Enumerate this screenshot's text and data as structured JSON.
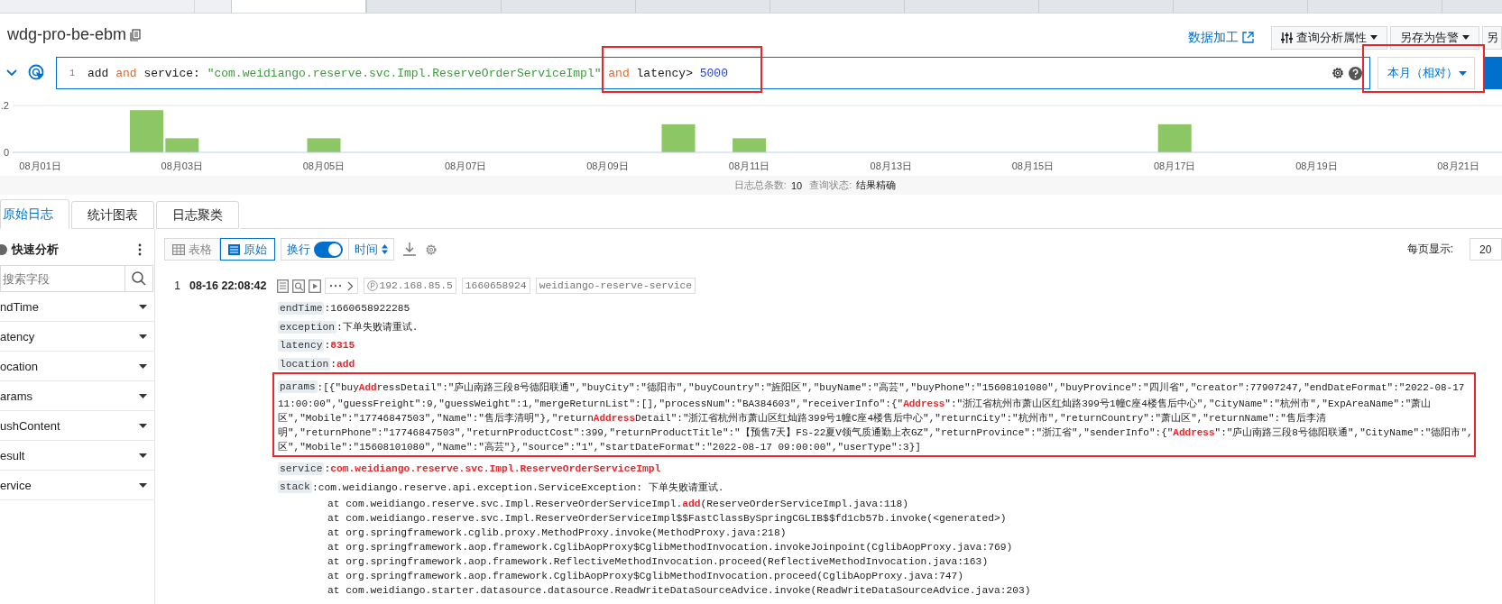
{
  "top_tabs": [
    {
      "selected": true
    },
    {
      "selected": false
    },
    {
      "selected": false
    },
    {
      "selected": false
    },
    {
      "selected": false
    },
    {
      "selected": false
    },
    {
      "selected": false
    },
    {
      "selected": false
    },
    {
      "selected": false
    },
    {
      "selected": false
    }
  ],
  "title": "wdg-pro-be-ebm",
  "header_actions": {
    "link": "数据加工",
    "buttons": [
      {
        "label": "查询分析属性",
        "kind": "attributes"
      },
      {
        "label": "另存为告警",
        "kind": "menu"
      },
      {
        "label": "另",
        "kind": "plain"
      }
    ]
  },
  "query": {
    "line_number": "1",
    "tokens": [
      {
        "text": "add",
        "kind": "plain"
      },
      {
        "text": "and",
        "kind": "keyword"
      },
      {
        "text": "service:",
        "kind": "plain"
      },
      {
        "text": "\"com.weidiango.reserve.svc.Impl.ReserveOrderServiceImpl\"",
        "kind": "string"
      },
      {
        "text": "and",
        "kind": "keyword"
      },
      {
        "text": "latency>",
        "kind": "plain"
      },
      {
        "text": "5000",
        "kind": "number"
      }
    ],
    "time_range": "本月（相对）"
  },
  "histogram": {
    "chart_data": {
      "type": "bar",
      "ylim": [
        0,
        0.2
      ],
      "yticks": [
        0,
        {
          "value": 0.2,
          "label": ".2"
        }
      ],
      "categories": [
        "08月01日",
        null,
        null,
        null,
        "08月03日",
        null,
        null,
        null,
        "08月05日",
        null,
        null,
        null,
        "08月07日",
        null,
        null,
        null,
        "08月09日",
        null,
        null,
        null,
        "08月11日",
        null,
        null,
        null,
        "08月13日",
        null,
        null,
        null,
        "08月15日",
        null,
        null,
        null,
        "08月17日",
        null,
        null,
        null,
        "08月19日",
        null,
        null,
        null,
        "08月21日",
        null
      ],
      "values": [
        0,
        0,
        0,
        0.18,
        0.06,
        0,
        0,
        0,
        0.06,
        0,
        0,
        0,
        0,
        0,
        0,
        0,
        0,
        0,
        0.12,
        0,
        0.06,
        0,
        0,
        0,
        0,
        0,
        0,
        0,
        0,
        0,
        0,
        0,
        0.12,
        0,
        0,
        0,
        0,
        0,
        0,
        0,
        0,
        0
      ]
    }
  },
  "summary": [
    {
      "label": "日志总条数:",
      "value": "10"
    },
    {
      "label": "查询状态:",
      "value": "结果精确"
    }
  ],
  "result_tabs": [
    {
      "label": "原始日志",
      "selected": true
    },
    {
      "label": "统计图表",
      "selected": false
    },
    {
      "label": "日志聚类",
      "selected": false
    }
  ],
  "sidebar": {
    "title": "快速分析",
    "search_placeholder": "搜索字段",
    "fields": [
      "ndTime",
      "atency",
      "ocation",
      "arams",
      "ushContent",
      "esult",
      "ervice"
    ]
  },
  "toolbar": {
    "views": [
      {
        "label": "表格",
        "kind": "table",
        "selected": false
      },
      {
        "label": "原始",
        "kind": "raw",
        "selected": true
      }
    ],
    "wrap": {
      "label": "换行",
      "on": true
    },
    "sort": {
      "label": "时间"
    },
    "page_size": {
      "label": "每页显示:",
      "value": "20"
    }
  },
  "log": {
    "index": "1",
    "time": "08-16 22:08:42",
    "tags": [
      {
        "text": "192.168.85.5",
        "kind": "ip"
      },
      {
        "text": "1660658924",
        "kind": "plain"
      },
      {
        "text": "weidiango-reserve-service",
        "kind": "plain"
      }
    ],
    "fields": [
      {
        "key": "endTime",
        "lines": [
          ":1660658922285"
        ]
      },
      {
        "key": "exception",
        "lines": [
          ":下单失败请重试."
        ]
      },
      {
        "key": "latency",
        "lines": [
          ":**8315**"
        ]
      },
      {
        "key": "location",
        "lines": [
          ":**add**"
        ]
      },
      {
        "key": "params",
        "lines": [
          ":[{\"buy**Add**ressDetail\":\"庐山南路三段8号德阳联通\",\"buyCity\":\"德阳市\",\"buyCountry\":\"旌阳区\",\"buyName\":\"高芸\",\"buyPhone\":\"15608101080\",\"buyProvince\":\"四川省\",\"creator\":77907247,\"endDateFormat\":\"2022-08-17",
          "11:00:00\",\"guessFreight\":9,\"guessWeight\":1,\"mergeReturnList\":[],\"processNum\":\"BA384603\",\"receiverInfo\":{\"**Address**\":\"浙江省杭州市萧山区红灿路399号1幢C座4楼售后中心\",\"CityName\":\"杭州市\",\"ExpAreaName\":\"萧山",
          "区\",\"Mobile\":\"17746847503\",\"Name\":\"售后李清明\"},\"return**Address**Detail\":\"浙江省杭州市萧山区红灿路399号1幢C座4楼售后中心\",\"returnCity\":\"杭州市\",\"returnCountry\":\"萧山区\",\"returnName\":\"售后李清",
          "明\",\"returnPhone\":\"17746847503\",\"returnProductCost\":399,\"returnProductTitle\":\"【预售7天】FS-22夏V领气质通勤上衣GZ\",\"returnProvince\":\"浙江省\",\"senderInfo\":{\"**Address**\":\"庐山南路三段8号德阳联通\",\"CityName\":\"德阳市\",",
          "区\",\"Mobile\":\"15608101080\",\"Name\":\"高芸\"},\"source\":\"1\",\"startDateFormat\":\"2022-08-17 09:00:00\",\"userType\":3}]"
        ]
      },
      {
        "key": "service",
        "lines": [
          ":**com.weidiango.reserve.svc.Impl.ReserveOrderServiceImpl**"
        ]
      },
      {
        "key": "stack",
        "lines": [
          ":com.weidiango.reserve.api.exception.ServiceException: 下单失败请重试."
        ],
        "trace": [
          "at com.weidiango.reserve.svc.Impl.ReserveOrderServiceImpl.**add**(ReserveOrderServiceImpl.java:118)",
          "at com.weidiango.reserve.svc.Impl.ReserveOrderServiceImpl$$FastClassBySpringCGLIB$$fd1cb57b.invoke(<generated>)",
          "at org.springframework.cglib.proxy.MethodProxy.invoke(MethodProxy.java:218)",
          "at org.springframework.aop.framework.CglibAopProxy$CglibMethodInvocation.invokeJoinpoint(CglibAopProxy.java:769)",
          "at org.springframework.aop.framework.ReflectiveMethodInvocation.proceed(ReflectiveMethodInvocation.java:163)",
          "at org.springframework.aop.framework.CglibAopProxy$CglibMethodInvocation.proceed(CglibAopProxy.java:747)",
          "at com.weidiango.starter.datasource.datasource.ReadWriteDataSourceAdvice.invoke(ReadWriteDataSourceAdvice.java:203)"
        ]
      }
    ]
  }
}
